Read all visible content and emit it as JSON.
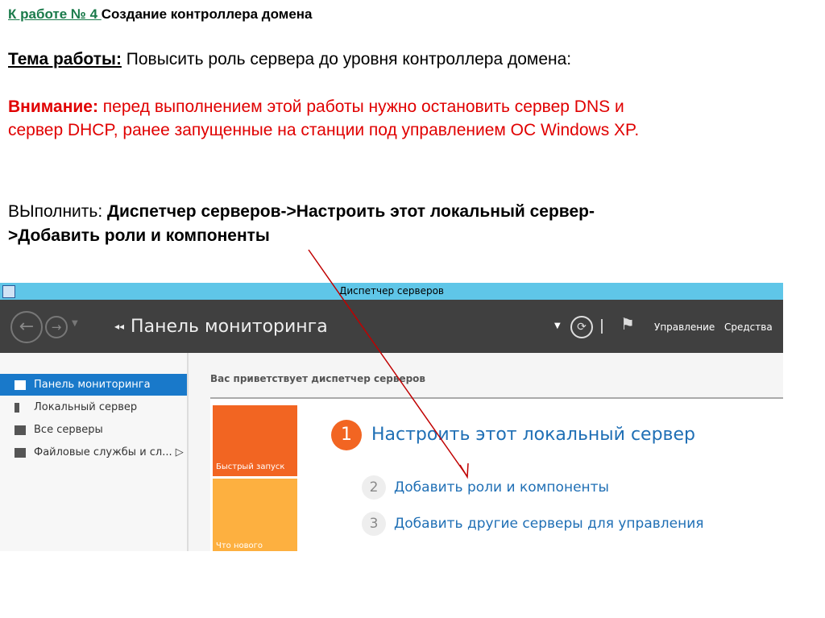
{
  "heading": {
    "link": "К работе № 4 ",
    "text": "Создание контроллера домена"
  },
  "topic": {
    "label": "Тема работы:",
    "text": " Повысить роль сервера до уровня контроллера домена:"
  },
  "warning": {
    "label": "Внимание:",
    "line1": " перед выполнением этой работы нужно остановить сервер DNS и",
    "line2": "сервер DHCP, ранее запущенные на станции под управлением ОС Windows XP."
  },
  "execute": {
    "label": "ВЫполнить: ",
    "line1": "Диспетчер серверов->Настроить этот локальный сервер-",
    "line2": ">Добавить роли и компоненты"
  },
  "window": {
    "title": "Диспетчер серверов",
    "page_title": "Панель мониторинга",
    "menu": [
      "Управление",
      "Средства"
    ],
    "sidebar": [
      {
        "label": "Панель мониторинга",
        "selected": true
      },
      {
        "label": "Локальный сервер"
      },
      {
        "label": "Все серверы"
      },
      {
        "label": "Файловые службы и сл..."
      }
    ],
    "welcome": "Вас приветствует диспетчер серверов",
    "tiles": [
      "Быстрый запуск",
      "Что нового"
    ],
    "steps": [
      {
        "n": "1",
        "label": "Настроить этот локальный сервер"
      },
      {
        "n": "2",
        "label": "Добавить роли и компоненты"
      },
      {
        "n": "3",
        "label": "Добавить другие серверы для управления"
      }
    ]
  },
  "colors": {
    "arrow": "#c00000",
    "accent": "#1979ca",
    "orange": "#f26522"
  }
}
